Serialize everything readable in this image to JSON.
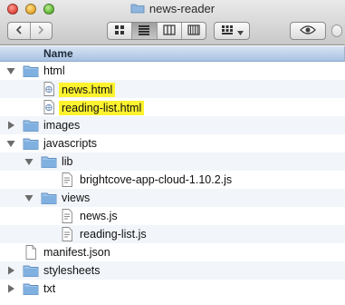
{
  "window": {
    "title": "news-reader"
  },
  "toolbar": {
    "back_icon": "chevron-left-icon",
    "forward_icon": "chevron-right-icon",
    "view_modes": [
      "icon-view",
      "list-view",
      "column-view",
      "cover-flow-view"
    ],
    "active_view": "list-view",
    "arrange_icon": "grid-arrange-icon",
    "quicklook_icon": "eye-icon"
  },
  "header": {
    "name_label": "Name"
  },
  "colors": {
    "highlight": "#fdf22f",
    "folder": "#7fb0e0",
    "header_bg": "#b9cfea"
  },
  "files": [
    {
      "name": "html",
      "type": "folder",
      "depth": 0,
      "expanded": true,
      "highlighted": false
    },
    {
      "name": "news.html",
      "type": "html-file",
      "depth": 1,
      "expanded": null,
      "highlighted": true
    },
    {
      "name": "reading-list.html",
      "type": "html-file",
      "depth": 1,
      "expanded": null,
      "highlighted": true
    },
    {
      "name": "images",
      "type": "folder",
      "depth": 0,
      "expanded": false,
      "highlighted": false
    },
    {
      "name": "javascripts",
      "type": "folder",
      "depth": 0,
      "expanded": true,
      "highlighted": false
    },
    {
      "name": "lib",
      "type": "folder",
      "depth": 1,
      "expanded": true,
      "highlighted": false
    },
    {
      "name": "brightcove-app-cloud-1.10.2.js",
      "type": "js-file",
      "depth": 2,
      "expanded": null,
      "highlighted": false
    },
    {
      "name": "views",
      "type": "folder",
      "depth": 1,
      "expanded": true,
      "highlighted": false
    },
    {
      "name": "news.js",
      "type": "js-file",
      "depth": 2,
      "expanded": null,
      "highlighted": false
    },
    {
      "name": "reading-list.js",
      "type": "js-file",
      "depth": 2,
      "expanded": null,
      "highlighted": false
    },
    {
      "name": "manifest.json",
      "type": "file",
      "depth": 0,
      "expanded": null,
      "highlighted": false
    },
    {
      "name": "stylesheets",
      "type": "folder",
      "depth": 0,
      "expanded": false,
      "highlighted": false
    },
    {
      "name": "txt",
      "type": "folder",
      "depth": 0,
      "expanded": false,
      "highlighted": false
    }
  ]
}
